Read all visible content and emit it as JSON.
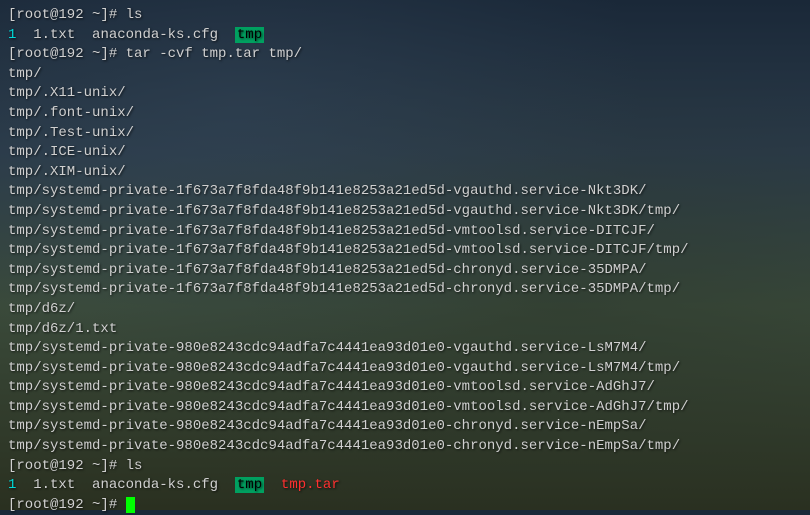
{
  "prompt1": "[root@192 ~]# ",
  "cmd1": "ls",
  "ls1_item1": "1",
  "ls1_item2": "1.txt",
  "ls1_item3": "anaconda-ks.cfg",
  "ls1_tmp": "tmp",
  "prompt2": "[root@192 ~]# ",
  "cmd2": "tar -cvf tmp.tar tmp/",
  "tar_lines": [
    "tmp/",
    "tmp/.X11-unix/",
    "tmp/.font-unix/",
    "tmp/.Test-unix/",
    "tmp/.ICE-unix/",
    "tmp/.XIM-unix/",
    "tmp/systemd-private-1f673a7f8fda48f9b141e8253a21ed5d-vgauthd.service-Nkt3DK/",
    "tmp/systemd-private-1f673a7f8fda48f9b141e8253a21ed5d-vgauthd.service-Nkt3DK/tmp/",
    "tmp/systemd-private-1f673a7f8fda48f9b141e8253a21ed5d-vmtoolsd.service-DITCJF/",
    "tmp/systemd-private-1f673a7f8fda48f9b141e8253a21ed5d-vmtoolsd.service-DITCJF/tmp/",
    "tmp/systemd-private-1f673a7f8fda48f9b141e8253a21ed5d-chronyd.service-35DMPA/",
    "tmp/systemd-private-1f673a7f8fda48f9b141e8253a21ed5d-chronyd.service-35DMPA/tmp/",
    "tmp/d6z/",
    "tmp/d6z/1.txt",
    "tmp/systemd-private-980e8243cdc94adfa7c4441ea93d01e0-vgauthd.service-LsM7M4/",
    "tmp/systemd-private-980e8243cdc94adfa7c4441ea93d01e0-vgauthd.service-LsM7M4/tmp/",
    "tmp/systemd-private-980e8243cdc94adfa7c4441ea93d01e0-vmtoolsd.service-AdGhJ7/",
    "tmp/systemd-private-980e8243cdc94adfa7c4441ea93d01e0-vmtoolsd.service-AdGhJ7/tmp/",
    "tmp/systemd-private-980e8243cdc94adfa7c4441ea93d01e0-chronyd.service-nEmpSa/",
    "tmp/systemd-private-980e8243cdc94adfa7c4441ea93d01e0-chronyd.service-nEmpSa/tmp/"
  ],
  "prompt3": "[root@192 ~]# ",
  "cmd3": "ls",
  "ls2_item1": "1",
  "ls2_item2": "1.txt",
  "ls2_item3": "anaconda-ks.cfg",
  "ls2_tmp": "tmp",
  "ls2_tar": "tmp.tar",
  "prompt4": "[root@192 ~]# "
}
